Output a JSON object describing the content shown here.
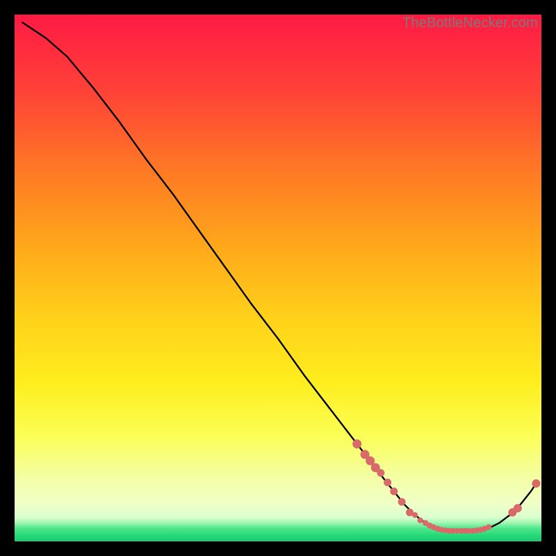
{
  "watermark": "TheBottleNecker.com",
  "colors": {
    "top": "#ff1a44",
    "mid1": "#ff9a1a",
    "mid2": "#ffe81a",
    "mid3": "#f7ff8a",
    "bottom_yellow": "#f1ffb8",
    "green": "#2ee87e",
    "line": "#000000",
    "dot": "#d86a6a"
  },
  "chart_data": {
    "type": "line",
    "title": "",
    "xlabel": "",
    "ylabel": "",
    "xlim": [
      0,
      100
    ],
    "ylim": [
      0,
      100
    ],
    "series": [
      {
        "name": "curve",
        "x": [
          1.5,
          6,
          10,
          15,
          20,
          25,
          30,
          35,
          40,
          45,
          50,
          55,
          60,
          65,
          70,
          72,
          74,
          76,
          78,
          80,
          82,
          84,
          86,
          88,
          90,
          92,
          94,
          96,
          98,
          99
        ],
        "y": [
          98.5,
          95.5,
          92,
          86,
          79.5,
          72.5,
          66,
          59,
          52,
          45,
          38.5,
          31.5,
          25,
          18.5,
          12,
          9.5,
          7,
          5,
          3.5,
          2.5,
          2,
          2,
          2,
          2,
          2.5,
          3.5,
          5,
          7,
          9.5,
          11
        ]
      }
    ],
    "points_highlight": [
      {
        "x": 65,
        "y": 18.5
      },
      {
        "x": 66.5,
        "y": 16.5
      },
      {
        "x": 67.5,
        "y": 15.3
      },
      {
        "x": 68.5,
        "y": 14
      },
      {
        "x": 69.5,
        "y": 13
      },
      {
        "x": 70.8,
        "y": 11.2
      },
      {
        "x": 72,
        "y": 9.5
      },
      {
        "x": 73.5,
        "y": 7.5
      },
      {
        "x": 75,
        "y": 5.5
      },
      {
        "x": 76,
        "y": 5
      },
      {
        "x": 77,
        "y": 4
      },
      {
        "x": 78,
        "y": 3.5
      },
      {
        "x": 78.8,
        "y": 3
      },
      {
        "x": 79.5,
        "y": 2.7
      },
      {
        "x": 80.3,
        "y": 2.4
      },
      {
        "x": 81,
        "y": 2.2
      },
      {
        "x": 81.8,
        "y": 2.1
      },
      {
        "x": 82.5,
        "y": 2
      },
      {
        "x": 83.2,
        "y": 2
      },
      {
        "x": 84,
        "y": 2
      },
      {
        "x": 84.8,
        "y": 2
      },
      {
        "x": 85.5,
        "y": 2
      },
      {
        "x": 86.2,
        "y": 2
      },
      {
        "x": 87,
        "y": 2
      },
      {
        "x": 87.8,
        "y": 2.1
      },
      {
        "x": 88.5,
        "y": 2.2
      },
      {
        "x": 89.2,
        "y": 2.4
      },
      {
        "x": 90,
        "y": 2.7
      },
      {
        "x": 94.5,
        "y": 5.5
      },
      {
        "x": 95.5,
        "y": 6.3
      },
      {
        "x": 99,
        "y": 11
      }
    ]
  }
}
